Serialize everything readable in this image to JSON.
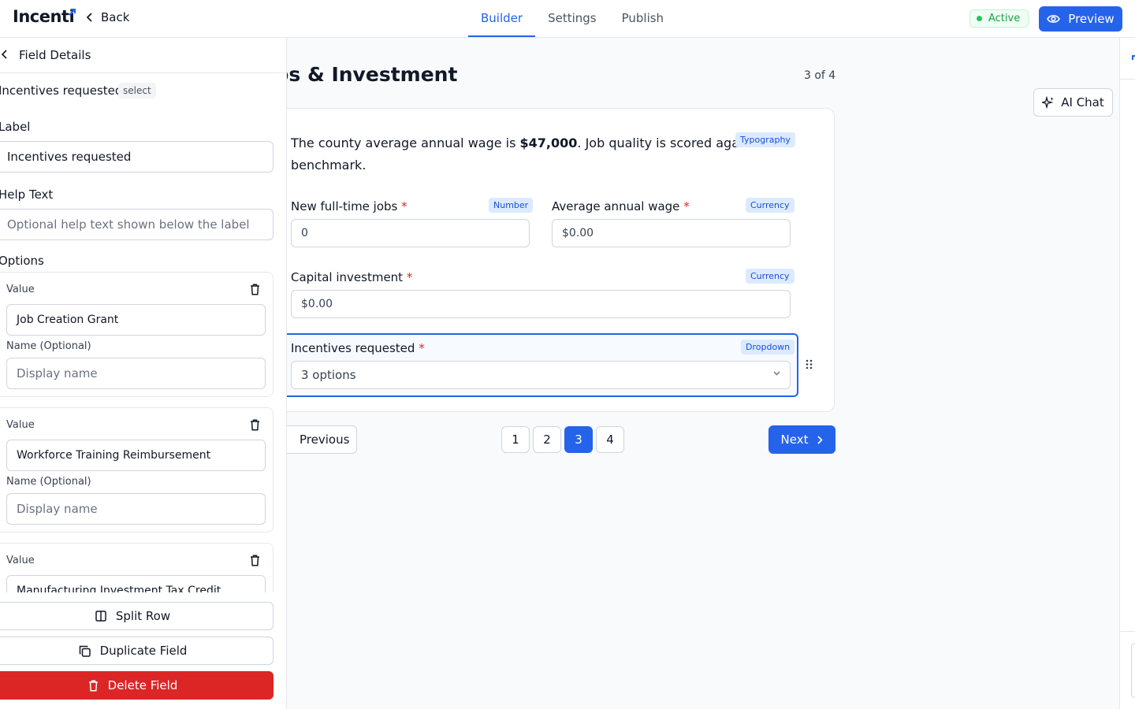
{
  "app": {
    "brand": "Incenti",
    "back_label": "Back"
  },
  "nav": {
    "tabs": [
      {
        "label": "Builder",
        "active": true
      },
      {
        "label": "Settings",
        "active": false
      },
      {
        "label": "Publish",
        "active": false
      }
    ]
  },
  "header_right": {
    "status": "Active",
    "preview_label": "Preview",
    "ai_chat_label": "AI Chat"
  },
  "field_details": {
    "title": "Field Details",
    "field_name": "Incentives requested",
    "field_type": "select",
    "label_heading": "Label",
    "label_value": "Incentives requested",
    "help_heading": "Help Text",
    "help_placeholder": "Optional help text shown below the label",
    "options_heading": "Options",
    "value_label": "Value",
    "name_label": "Name (Optional)",
    "name_placeholder": "Display name",
    "options": [
      {
        "value": "Job Creation Grant"
      },
      {
        "value": "Workforce Training Reimbursement"
      },
      {
        "value": "Manufacturing Investment Tax Credit"
      }
    ],
    "split_row_label": "Split Row",
    "duplicate_label": "Duplicate Field",
    "delete_label": "Delete Field"
  },
  "page": {
    "title": "Jobs & Investment",
    "counter": "3 of 4",
    "typography": {
      "badge": "Typography",
      "text_before": "The county average annual wage is ",
      "text_bold": "$47,000",
      "text_after": ". Job quality is scored against this",
      "text_line2": "benchmark."
    },
    "fields": {
      "jobs": {
        "label": "New full-time jobs",
        "badge": "Number",
        "placeholder": "0"
      },
      "wage": {
        "label": "Average annual wage",
        "badge": "Currency",
        "placeholder": "$0.00"
      },
      "capital": {
        "label": "Capital investment",
        "badge": "Currency",
        "placeholder": "$0.00"
      },
      "incentives": {
        "label": "Incentives requested",
        "badge": "Dropdown",
        "value": "3 options"
      }
    },
    "required_mark": "*"
  },
  "pager": {
    "previous": "Previous",
    "next": "Next",
    "pages": [
      "1",
      "2",
      "3",
      "4"
    ],
    "current": "3"
  },
  "colors": {
    "accent": "#2563eb",
    "danger": "#dc2626",
    "success": "#16a34a"
  }
}
